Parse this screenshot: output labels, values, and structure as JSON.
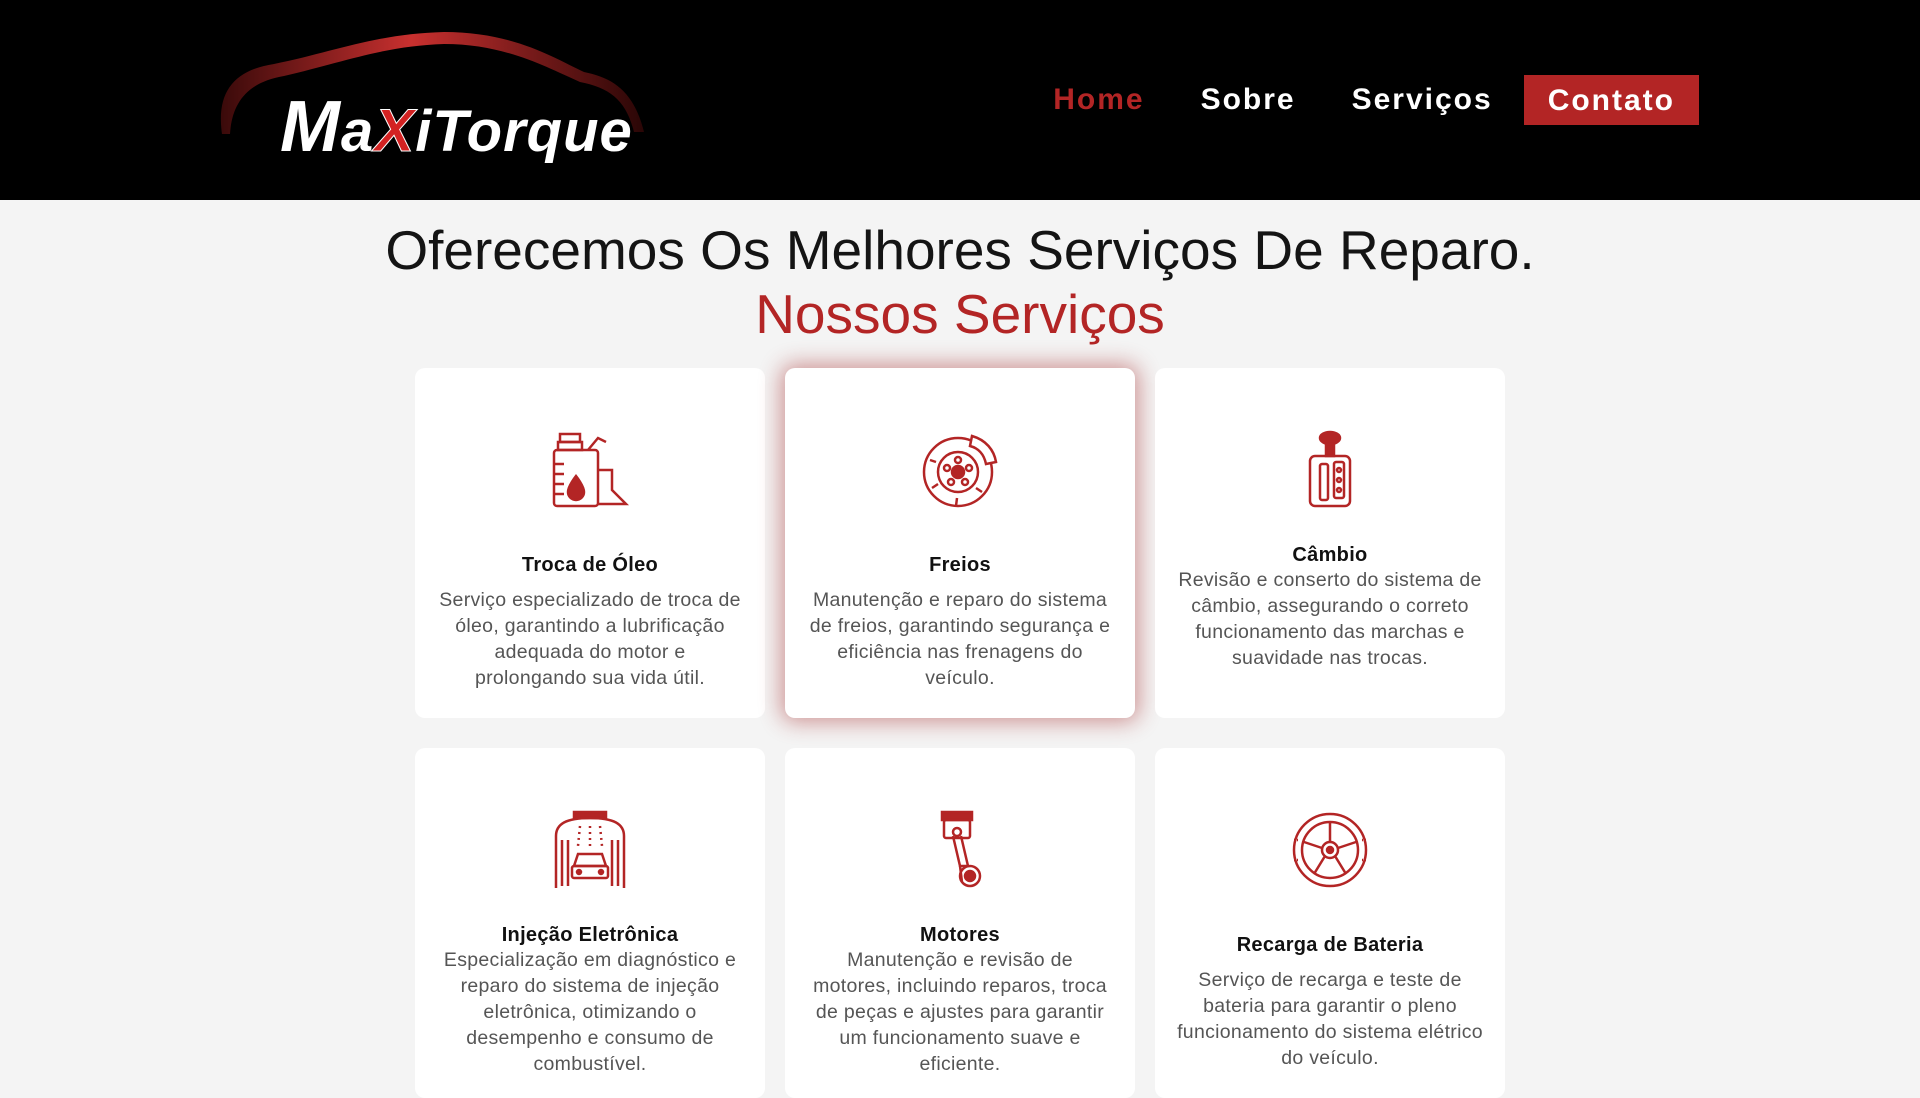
{
  "brand": {
    "name": "MaxiTorque",
    "parts": [
      "M",
      "a",
      "X",
      "iTorque"
    ]
  },
  "nav": {
    "items": [
      "Home",
      "Sobre",
      "Serviços"
    ],
    "cta": "Contato"
  },
  "hero": {
    "headline": "Oferecemos Os Melhores Serviços De Reparo.",
    "subheadline": "Nossos Serviços"
  },
  "colors": {
    "accent": "#b32525",
    "topbar": "#000000",
    "background": "#f4f4f4"
  },
  "services": [
    {
      "title": "Troca de Óleo",
      "description": "Serviço especializado de troca de óleo, garantindo a lubrificação adequada do motor e prolongando sua vida útil.",
      "icon": "oil-can-icon"
    },
    {
      "title": "Freios",
      "description": "Manutenção e reparo do sistema de freios, garantindo segurança e eficiência nas frenagens do veículo.",
      "icon": "brake-disc-icon"
    },
    {
      "title": "Câmbio",
      "description": "Revisão e conserto do sistema de câmbio, assegurando o correto funcionamento das marchas e suavidade nas trocas.",
      "icon": "gear-shift-icon"
    },
    {
      "title": "Injeção Eletrônica",
      "description": "Especialização em diagnóstico e reparo do sistema de injeção eletrônica, otimizando o desempenho e consumo de combustível.",
      "icon": "car-wash-icon"
    },
    {
      "title": "Motores",
      "description": "Manutenção e revisão de motores, incluindo reparos, troca de peças e ajustes para garantir um funcionamento suave e eficiente.",
      "icon": "piston-icon"
    },
    {
      "title": "Recarga de Bateria",
      "description": "Serviço de recarga e teste de bateria para garantir o pleno funcionamento do sistema elétrico do veículo.",
      "icon": "wheel-icon"
    }
  ]
}
